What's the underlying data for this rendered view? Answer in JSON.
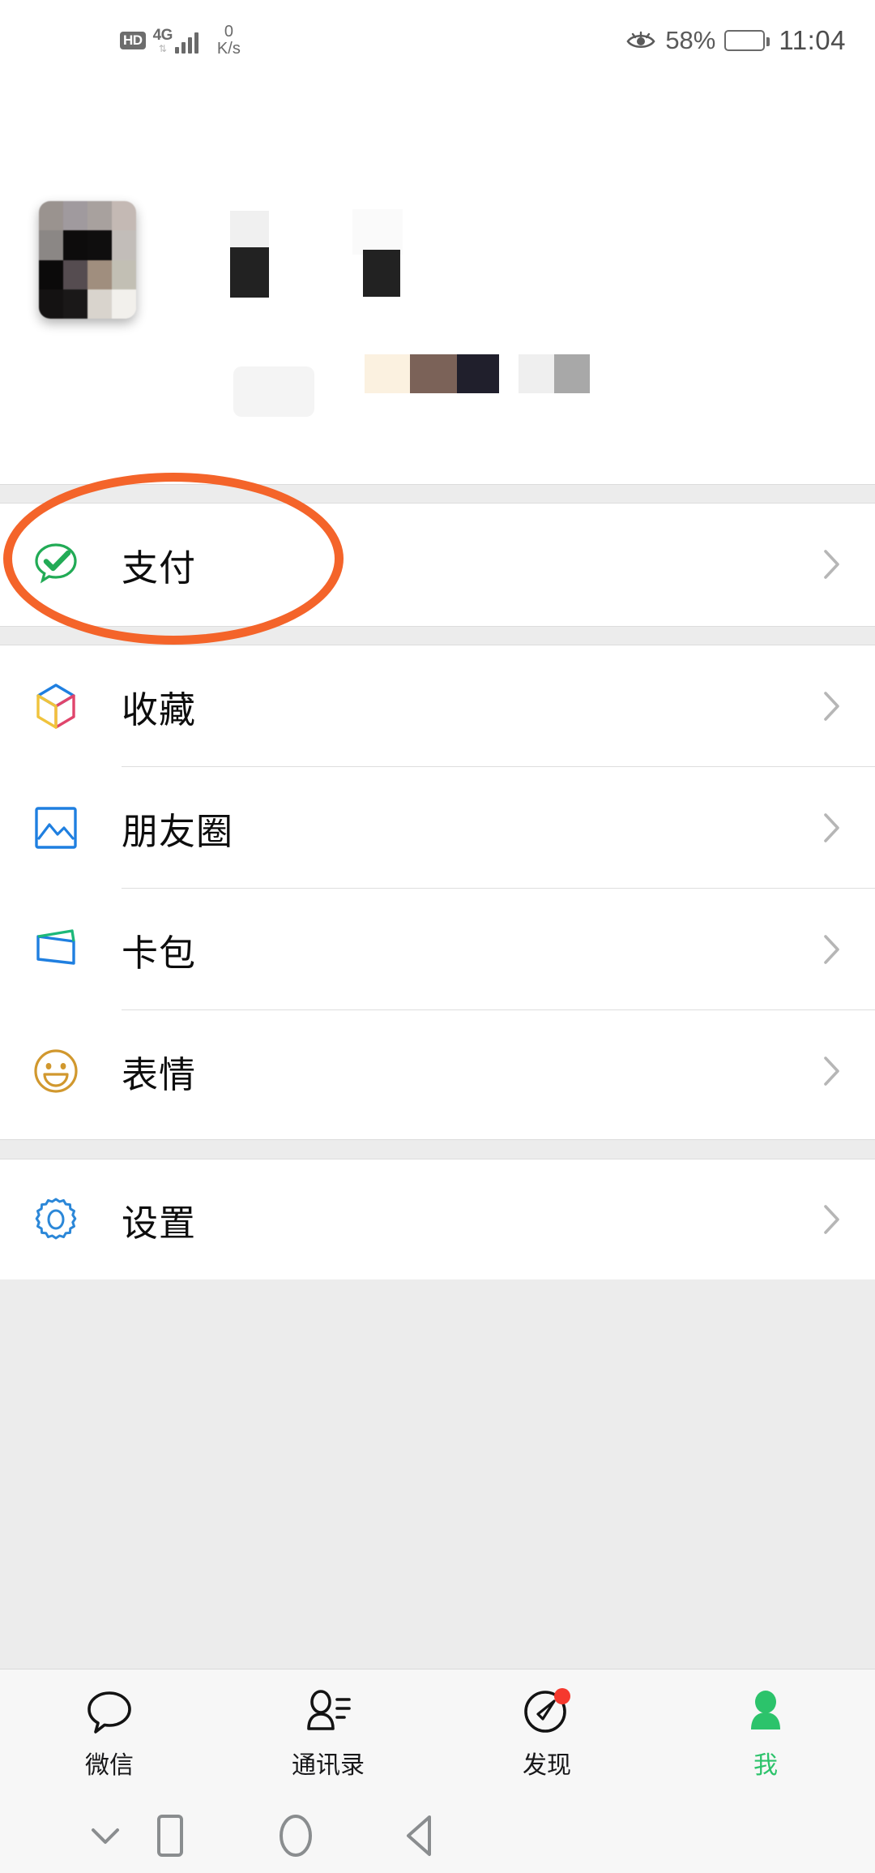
{
  "status_bar": {
    "hd_badge": "HD",
    "network_type": "4G",
    "network_arrows": "⇅",
    "data_speed_value": "0",
    "data_speed_unit": "K/s",
    "battery_percent": "58%",
    "battery_level": 58,
    "clock": "11:04",
    "eye_icon": "eye-care-icon"
  },
  "profile": {
    "avatar": "avatar-pixelated-redacted",
    "nickname": "",
    "wxid": "",
    "redacted": true
  },
  "sections": [
    {
      "id": "pay-section",
      "items": [
        {
          "id": "pay",
          "label": "支付",
          "icon": "wechat-pay-icon",
          "chevron": "chevron-right-icon",
          "highlighted": true
        }
      ]
    },
    {
      "id": "content-section",
      "items": [
        {
          "id": "favorites",
          "label": "收藏",
          "icon": "favorites-cube-icon",
          "chevron": "chevron-right-icon",
          "highlighted": false
        },
        {
          "id": "moments",
          "label": "朋友圈",
          "icon": "moments-photo-icon",
          "chevron": "chevron-right-icon",
          "highlighted": false
        },
        {
          "id": "cards",
          "label": "卡包",
          "icon": "cards-wallet-icon",
          "chevron": "chevron-right-icon",
          "highlighted": false
        },
        {
          "id": "stickers",
          "label": "表情",
          "icon": "stickers-smiley-icon",
          "chevron": "chevron-right-icon",
          "highlighted": false
        }
      ]
    },
    {
      "id": "settings-section",
      "items": [
        {
          "id": "settings",
          "label": "设置",
          "icon": "settings-gear-icon",
          "chevron": "chevron-right-icon",
          "highlighted": false
        }
      ]
    }
  ],
  "tabbar": {
    "active_index": 3,
    "active_color": "#2cc36b",
    "badge_color": "#f5392e",
    "tabs": [
      {
        "id": "chats",
        "label": "微信",
        "icon": "chat-bubble-icon",
        "badge": false
      },
      {
        "id": "contacts",
        "label": "通讯录",
        "icon": "contacts-icon",
        "badge": false
      },
      {
        "id": "discover",
        "label": "发现",
        "icon": "compass-icon",
        "badge": true
      },
      {
        "id": "me",
        "label": "我",
        "icon": "person-icon",
        "badge": false
      }
    ]
  },
  "navbar": {
    "buttons": [
      {
        "id": "hide-nav",
        "icon": "chevron-down-icon"
      },
      {
        "id": "recents",
        "icon": "square-icon"
      },
      {
        "id": "home",
        "icon": "circle-icon"
      },
      {
        "id": "back",
        "icon": "triangle-left-icon"
      }
    ]
  },
  "annotation": {
    "shape": "ellipse",
    "color": "#f4642a",
    "target": "支付"
  }
}
